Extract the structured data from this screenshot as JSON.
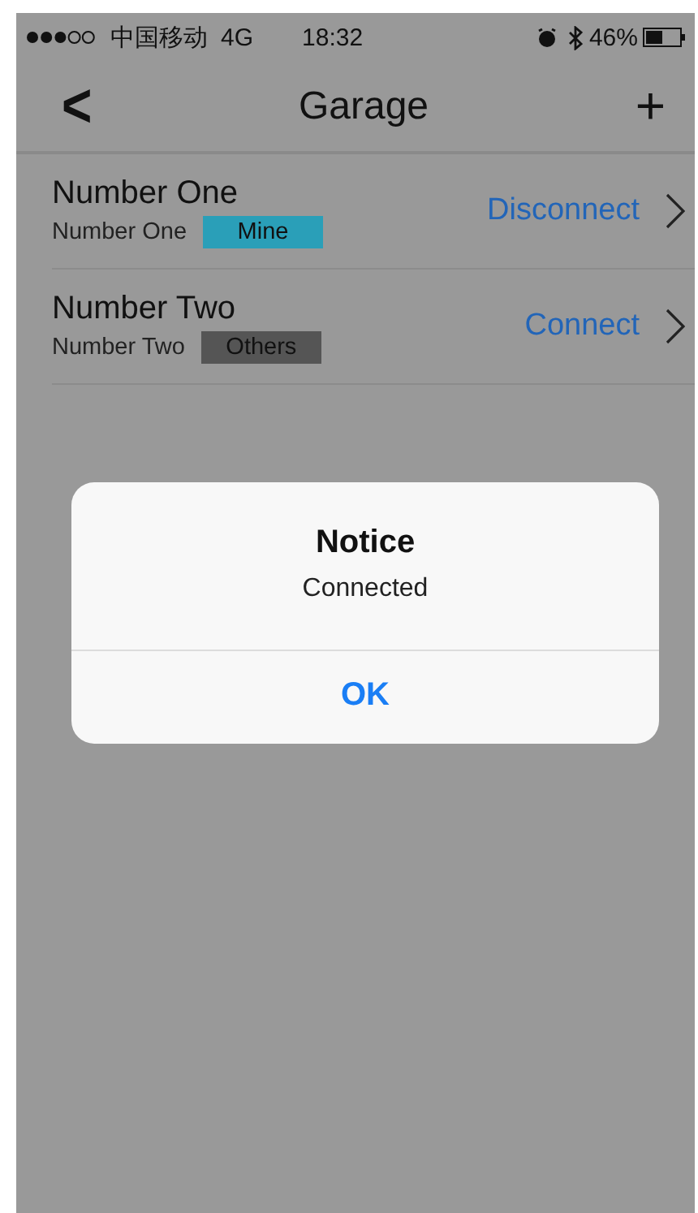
{
  "status_bar": {
    "carrier": "中国移动",
    "network": "4G",
    "time": "18:32",
    "battery": "46%"
  },
  "nav": {
    "back": "<",
    "title": "Garage",
    "add": "+"
  },
  "garages": [
    {
      "name": "Number One",
      "subtitle": "Number One",
      "tag": {
        "label": "Mine",
        "color": "#2a9fb8"
      },
      "action": "Disconnect"
    },
    {
      "name": "Number Two",
      "subtitle": "Number Two",
      "tag": {
        "label": "Others",
        "color": "#555555"
      },
      "action": "Connect"
    }
  ],
  "dialog": {
    "title": "Notice",
    "message": "Connected",
    "button": "OK"
  }
}
